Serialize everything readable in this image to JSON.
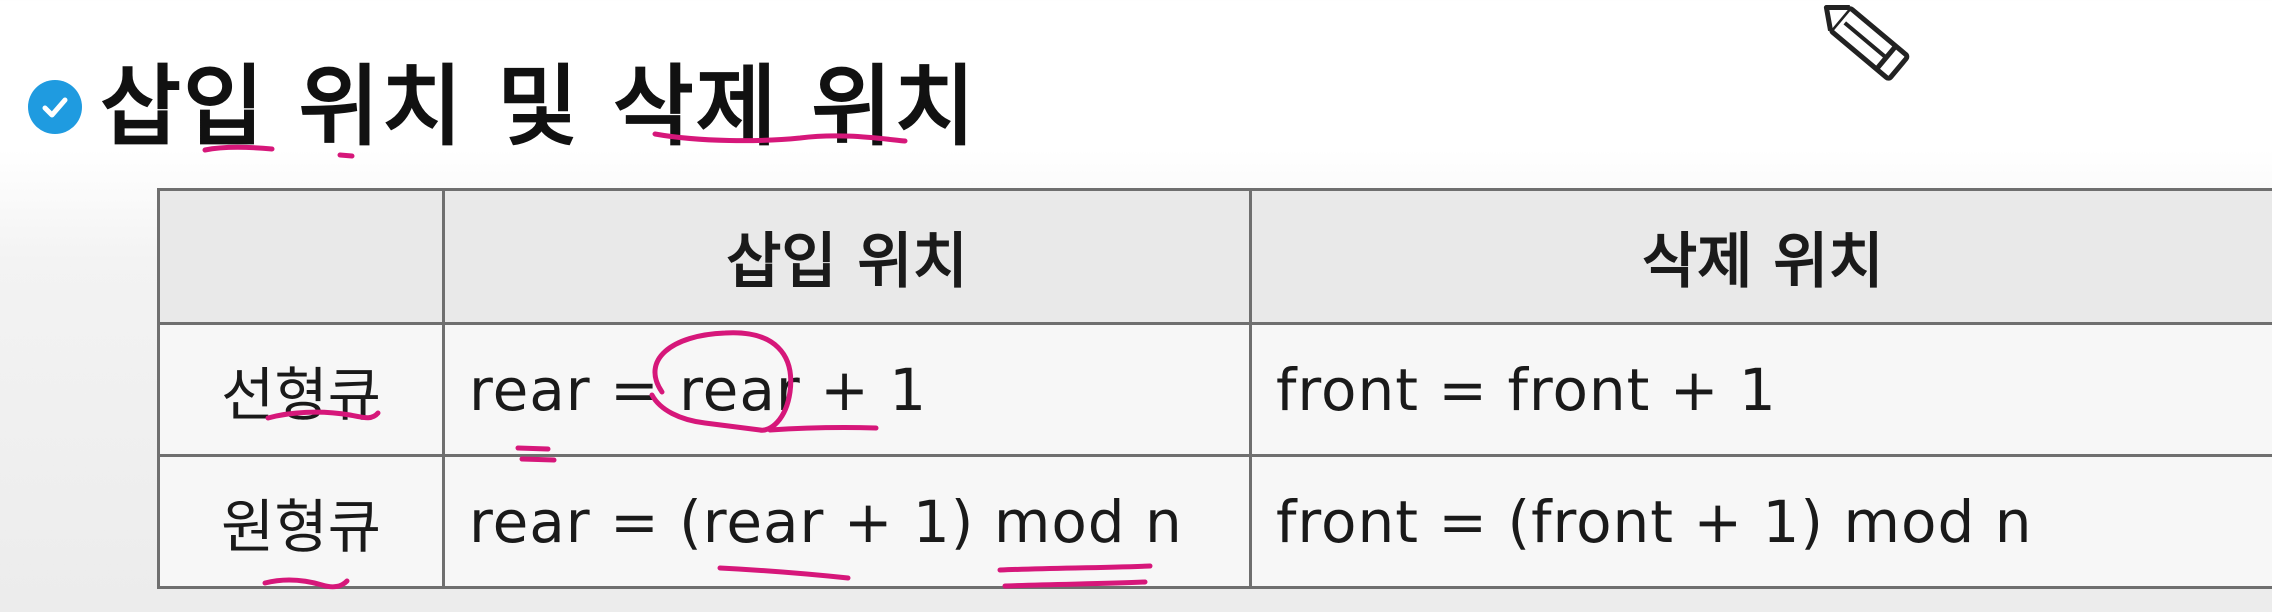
{
  "heading": {
    "title": "삽입 위치 및 삭제 위치",
    "icon": "check-circle-icon",
    "icon_color": "#1f9be0"
  },
  "table": {
    "columns": [
      "",
      "삽입 위치",
      "삭제 위치"
    ],
    "rows": [
      {
        "label": "선형큐",
        "insert": "rear = rear + 1",
        "delete": "front = front + 1"
      },
      {
        "label": "원형큐",
        "insert": "rear = (rear + 1) mod n",
        "delete": "front = (front + 1) mod n"
      }
    ]
  },
  "annotation_color": "#d6177a",
  "toolbar_icon": "pencil-icon"
}
